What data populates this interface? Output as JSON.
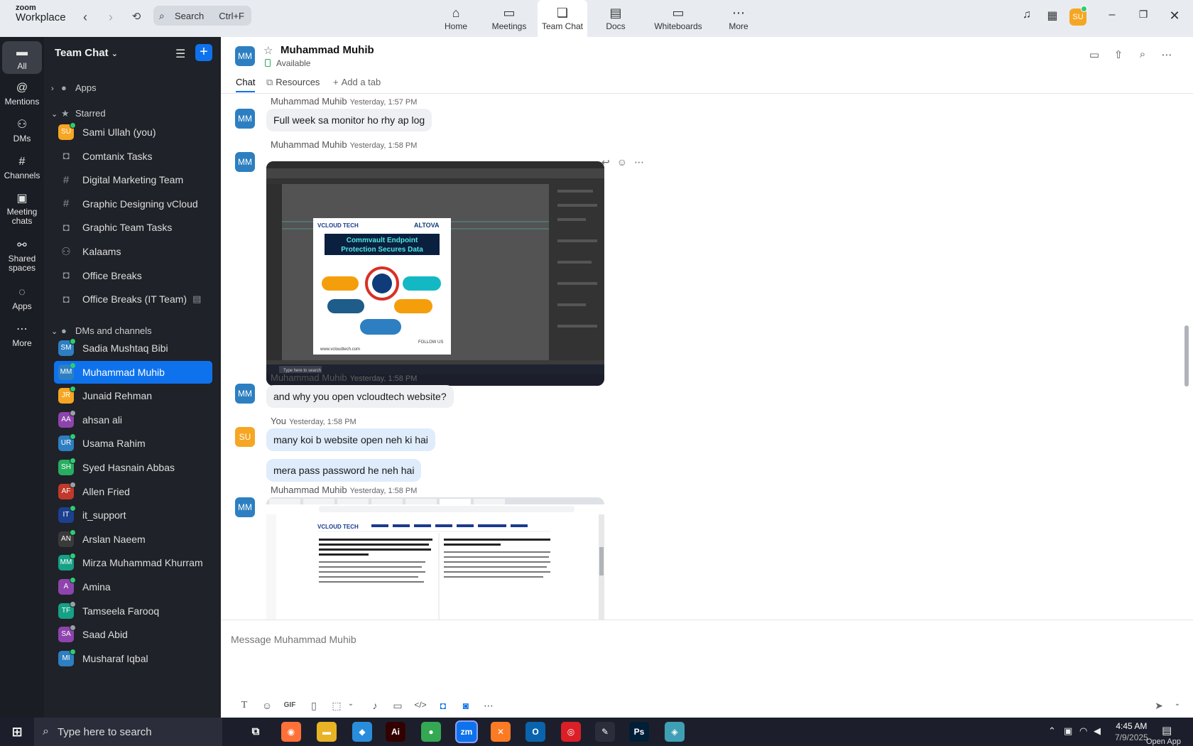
{
  "app": {
    "brand_top": "zoom",
    "brand_bottom": "Workplace"
  },
  "search": {
    "label": "Search",
    "shortcut": "Ctrl+F"
  },
  "top_tabs": [
    {
      "label": "Home",
      "icon": "home-icon"
    },
    {
      "label": "Meetings",
      "icon": "video-icon"
    },
    {
      "label": "Team Chat",
      "icon": "chat-icon"
    },
    {
      "label": "Docs",
      "icon": "doc-icon"
    },
    {
      "label": "Whiteboards",
      "icon": "whiteboard-icon"
    },
    {
      "label": "More",
      "icon": "ellipsis-icon"
    }
  ],
  "user": {
    "initials": "SU",
    "color": "#f5a623"
  },
  "rail": [
    {
      "label": "All",
      "icon": "chat-bubble-icon"
    },
    {
      "label": "Mentions",
      "icon": "at-icon"
    },
    {
      "label": "DMs",
      "icon": "people-icon"
    },
    {
      "label": "Channels",
      "icon": "hash-icon"
    },
    {
      "label": "Meeting chats",
      "icon": "calendar-icon"
    },
    {
      "label": "Shared spaces",
      "icon": "share-icon"
    },
    {
      "label": "Apps",
      "icon": "apps-icon"
    },
    {
      "label": "More",
      "icon": "ellipsis-icon"
    }
  ],
  "sidebar": {
    "title": "Team Chat",
    "sections": {
      "apps": "Apps",
      "starred": "Starred",
      "dms": "DMs and channels"
    },
    "starred": [
      {
        "label": "Sami Ullah (you)",
        "type": "avatar",
        "initials": "SU",
        "color": "#f5a623",
        "status": "#2ecc71"
      },
      {
        "label": "Comtanix Tasks",
        "type": "lock"
      },
      {
        "label": "Digital Marketing Team",
        "type": "hash"
      },
      {
        "label": "Graphic Designing vCloud",
        "type": "hash"
      },
      {
        "label": "Graphic Team Tasks",
        "type": "lock"
      },
      {
        "label": "Kalaams",
        "type": "group"
      },
      {
        "label": "Office Breaks",
        "type": "lock"
      },
      {
        "label": "Office Breaks (IT Team)",
        "type": "lock",
        "tail": "▤"
      }
    ],
    "dms": [
      {
        "label": "Sadia Mushtaq Bibi",
        "initials": "SM",
        "color": "#2d7fc1",
        "status": "#2ecc71"
      },
      {
        "label": "Muhammad Muhib",
        "initials": "MM",
        "color": "#2d7fc1",
        "status": "#2ecc71",
        "active": true
      },
      {
        "label": "Junaid Rehman",
        "initials": "JR",
        "color": "#f5a623",
        "status": "#2ecc71"
      },
      {
        "label": "ahsan ali",
        "initials": "AA",
        "color": "#8e44ad",
        "status": "#9aa0a6"
      },
      {
        "label": "Usama Rahim",
        "initials": "UR",
        "color": "#2d7fc1",
        "status": "#2ecc71"
      },
      {
        "label": "Syed Hasnain Abbas",
        "initials": "SH",
        "color": "#27ae60",
        "status": "#2ecc71"
      },
      {
        "label": "Allen Fried",
        "initials": "AF",
        "color": "#c0392b",
        "status": "#9aa0a6"
      },
      {
        "label": "it_support",
        "initials": "IT",
        "color": "#1c3f8f",
        "status": "#2ecc71"
      },
      {
        "label": "Arslan Naeem",
        "initials": "AN",
        "color": "#3a3a3a",
        "status": "#2ecc71"
      },
      {
        "label": "Mirza Muhammad Khurram",
        "initials": "MM",
        "color": "#16a085",
        "status": "#2ecc71"
      },
      {
        "label": "Amina",
        "initials": "A",
        "color": "#8e44ad",
        "status": "#2ecc71"
      },
      {
        "label": "Tamseela Farooq",
        "initials": "TF",
        "color": "#16a085",
        "status": "#9aa0a6"
      },
      {
        "label": "Saad Abid",
        "initials": "SA",
        "color": "#8e44ad",
        "status": "#9aa0a6"
      },
      {
        "label": "Musharaf Iqbal",
        "initials": "MI",
        "color": "#2d7fc1",
        "status": "#2ecc71"
      }
    ]
  },
  "chat": {
    "initials": "MM",
    "name": "Muhammad Muhib",
    "status": "Available",
    "tabs": [
      "Chat",
      "Resources",
      "Add a tab"
    ],
    "messages": [
      {
        "sender": "Muhammad Muhib",
        "time": "Yesterday, 1:57 PM",
        "text": "Full week sa monitor ho rhy ap log"
      },
      {
        "sender": "Muhammad Muhib",
        "time": "Yesterday, 1:58 PM"
      },
      {
        "sender": "Muhammad Muhib",
        "time": "Yesterday, 1:58 PM",
        "text": "and why you open vcloudtech website?"
      },
      {
        "sender": "You",
        "time": "Yesterday, 1:58 PM",
        "text": "many koi b website open neh ki hai",
        "text2": "mera pass password he neh hai"
      },
      {
        "sender": "Muhammad Muhib",
        "time": "Yesterday, 1:58 PM"
      }
    ],
    "screenshot1": {
      "brand": "VCLOUD TECH",
      "partner": "ALTOVA",
      "headline1": "Commvault Endpoint",
      "headline2": "Protection Secures Data",
      "site": "www.vcloudtech.com",
      "follow": "FOLLOW US",
      "search": "Type here to search"
    },
    "screenshot2": {
      "brand": "VCLOUD TECH",
      "left_heading": "vCloud Tech Cloud Architects Help You Maintain Application Availability and Data Integrity While Efficiently Migrating Workloads Between Public, Private, Hybrid, or Multi-Cloud Environments.",
      "right_heading": "The Sooner Your Workload Leaves the Data Center, the Faster You Will Be Able to Pivot"
    },
    "composer_placeholder": "Message Muhammad Muhib",
    "composer_gif": "GIF"
  },
  "taskbar": {
    "search_placeholder": "Type here to search",
    "time": "4:45 AM",
    "date": "7/9/2025",
    "open_app": "Open App",
    "apps": [
      {
        "name": "firefox",
        "label": "◉",
        "color": "#ff7139"
      },
      {
        "name": "file-explorer",
        "label": "▬",
        "color": "#e8b325"
      },
      {
        "name": "vscode",
        "label": "◆",
        "color": "#2a8ddc"
      },
      {
        "name": "illustrator",
        "label": "Ai",
        "color": "#330000"
      },
      {
        "name": "chrome",
        "label": "●",
        "color": "#34a853"
      },
      {
        "name": "zoom",
        "label": "zm",
        "color": "#0e72ed"
      },
      {
        "name": "xampp",
        "label": "✕",
        "color": "#fb7a24"
      },
      {
        "name": "outlook",
        "label": "O",
        "color": "#0a64ad"
      },
      {
        "name": "creative-cloud",
        "label": "◎",
        "color": "#da1f26"
      },
      {
        "name": "pen-tool",
        "label": "✎",
        "color": "#2b2e3a"
      },
      {
        "name": "photoshop",
        "label": "Ps",
        "color": "#001e36"
      },
      {
        "name": "app-diamond",
        "label": "◈",
        "color": "#3fa0b5"
      }
    ]
  }
}
